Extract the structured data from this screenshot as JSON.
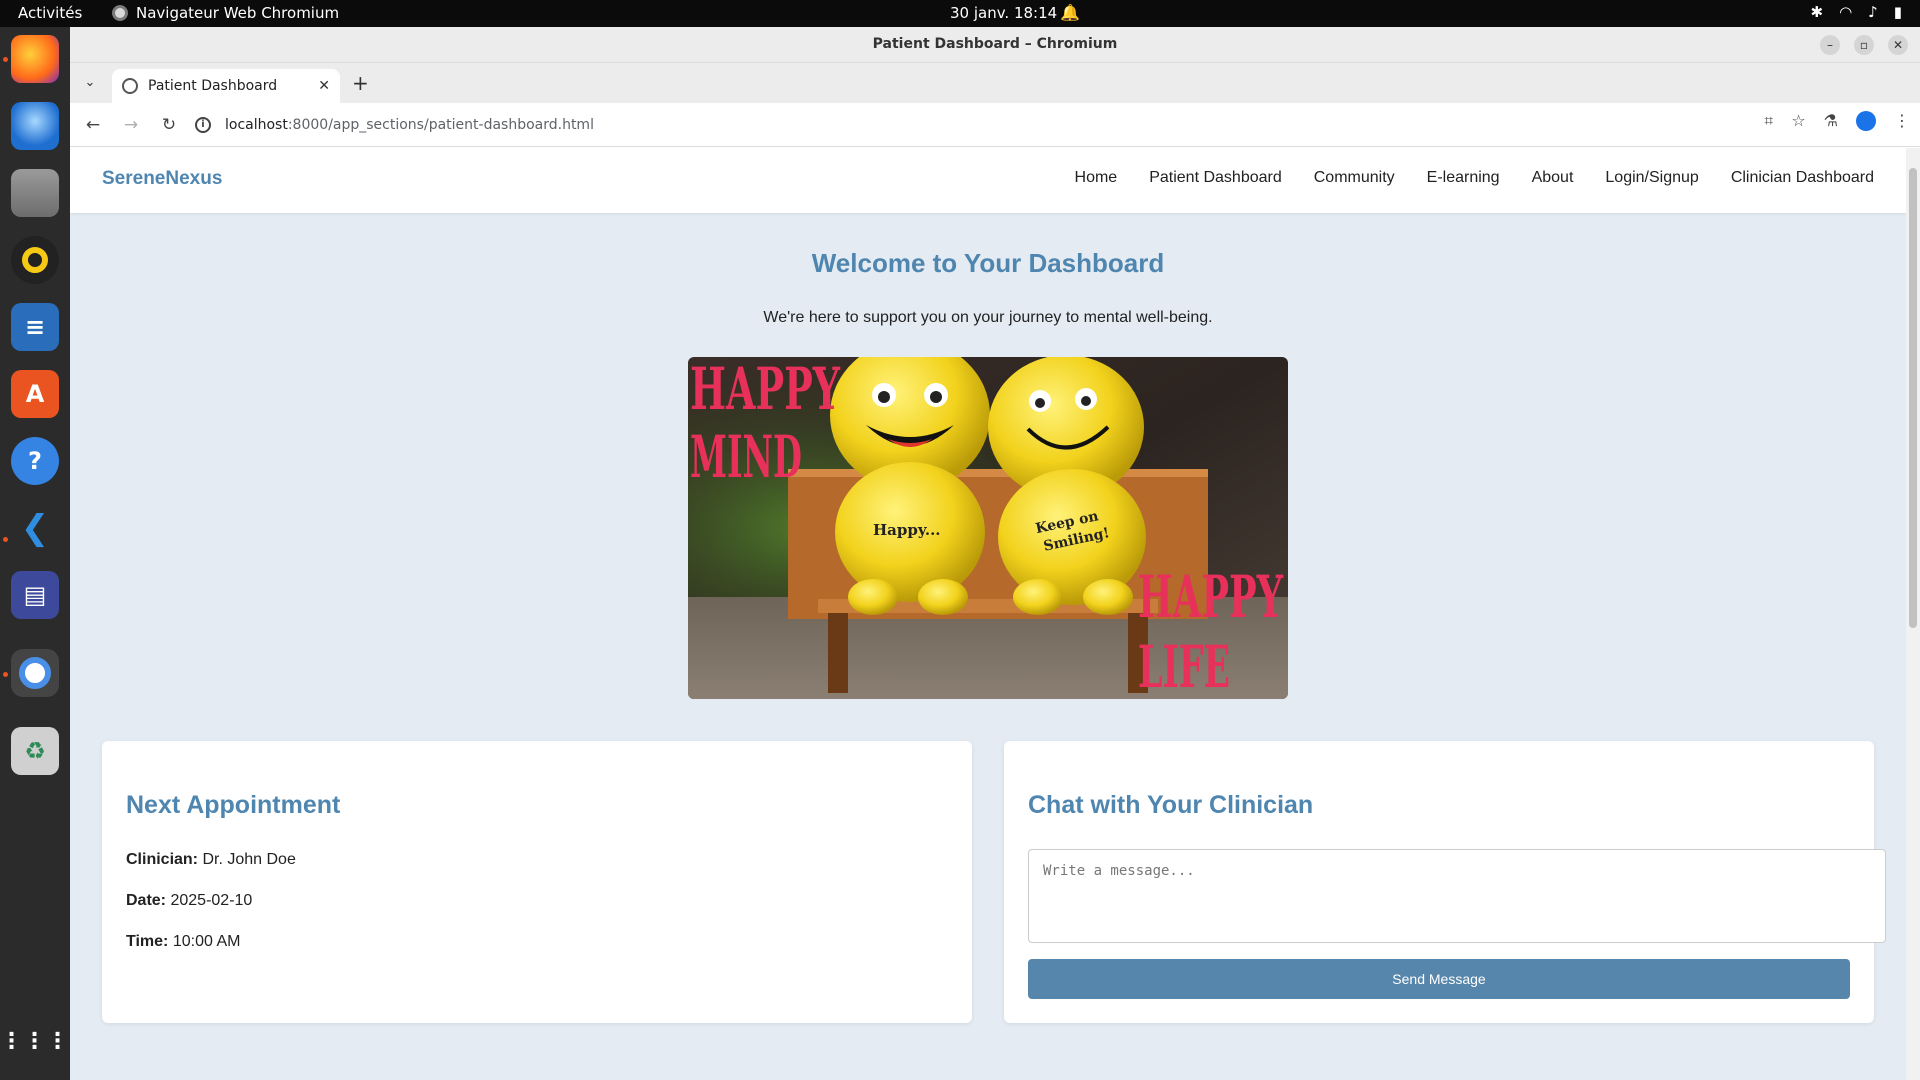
{
  "system": {
    "activities_label": "Activités",
    "app_name": "Navigateur Web Chromium",
    "clock": "30 janv.  18:14"
  },
  "dock": {
    "items": [
      "firefox-icon",
      "thunderbird-icon",
      "files-icon",
      "rhythmbox-icon",
      "writer-icon",
      "app-center-icon",
      "help-icon",
      "vscode-icon",
      "screenshot-tool-icon",
      "chromium-icon",
      "trash-icon",
      "show-apps-icon"
    ]
  },
  "browser": {
    "window_title": "Patient Dashboard – Chromium",
    "tab_title": "Patient Dashboard",
    "url_host": "localhost",
    "url_path": ":8000/app_sections/patient-dashboard.html"
  },
  "site": {
    "brand": "SereneNexus",
    "nav": [
      "Home",
      "Patient Dashboard",
      "Community",
      "E-learning",
      "About",
      "Login/Signup",
      "Clinician Dashboard"
    ],
    "welcome_title": "Welcome to Your Dashboard",
    "tagline": "We're here to support you on your journey to mental well-being.",
    "hero_text": {
      "top_left": [
        "HAPPY",
        "MIND"
      ],
      "bottom_right": [
        "HAPPY",
        "LIFE"
      ],
      "plush_left": "Happy...",
      "plush_right_1": "Keep on",
      "plush_right_2": "Smiling!"
    }
  },
  "appointment": {
    "heading": "Next Appointment",
    "clinician_label": "Clinician:",
    "clinician_value": "Dr. John Doe",
    "date_label": "Date:",
    "date_value": "2025-02-10",
    "time_label": "Time:",
    "time_value": "10:00 AM"
  },
  "chat": {
    "heading": "Chat with Your Clinician",
    "placeholder": "Write a message...",
    "send_label": "Send Message"
  },
  "colors": {
    "accent": "#4f86b0",
    "button": "#5786ac",
    "page_bg": "#e4ebf2",
    "hero_text": "#e8315a"
  }
}
